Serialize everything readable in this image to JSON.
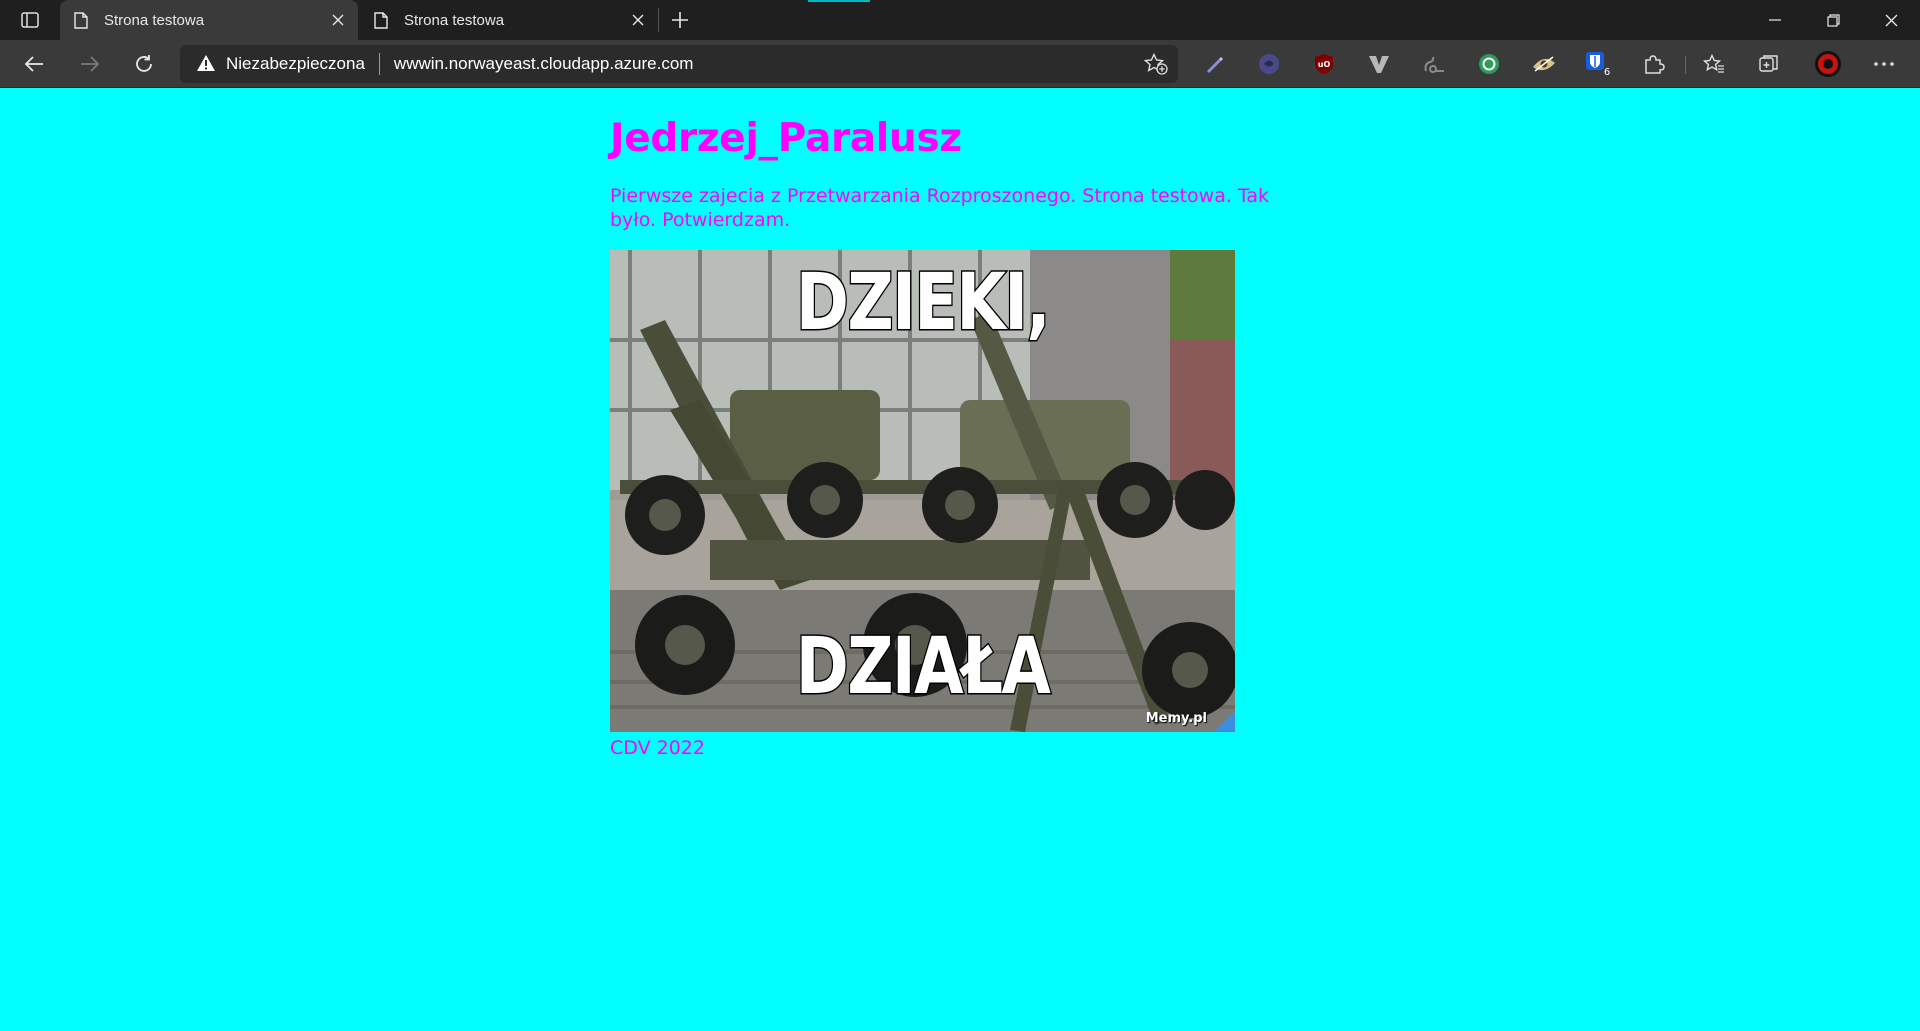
{
  "browser": {
    "tabs": [
      {
        "title": "Strona testowa",
        "active": true
      },
      {
        "title": "Strona testowa",
        "active": false
      }
    ],
    "address_bar": {
      "security_label": "Niezabezpieczona",
      "url": "wwwin.norwayeast.cloudapp.azure.com"
    },
    "extensions": [
      {
        "icon": "pen-icon"
      },
      {
        "icon": "privacy-badger-icon"
      },
      {
        "icon": "ublock-origin-icon",
        "label": "uO"
      },
      {
        "icon": "vivaldi-v-icon"
      },
      {
        "icon": "script-icon"
      },
      {
        "icon": "green-sync-icon"
      },
      {
        "icon": "eye-icon"
      },
      {
        "icon": "bitwarden-icon",
        "badge": "6"
      },
      {
        "icon": "puzzle-icon"
      }
    ],
    "colors": {
      "accent": "#00b7c3",
      "chrome_dark": "#1f1f1f",
      "chrome_toolbar": "#3a3a3a"
    }
  },
  "page": {
    "background": "#00ffff",
    "text_color": "#ff00ff",
    "heading": "Jedrzej_Paralusz",
    "intro": "Pierwsze zajecia z Przetwarzania Rozproszonego. Strona testowa. Tak było. Potwierdzam.",
    "meme": {
      "top_text": "DZIEKI,",
      "bottom_text": "DZIAŁA",
      "watermark": "Memy.pl"
    },
    "footer": "CDV 2022"
  }
}
